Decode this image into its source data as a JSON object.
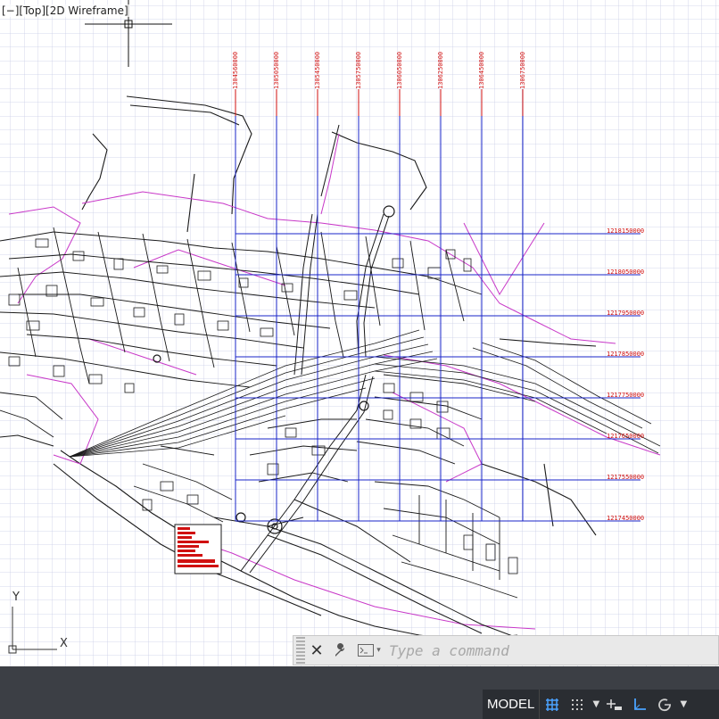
{
  "viewport": {
    "controls_label": "[−][Top][2D Wireframe]",
    "ucs_y": "Y",
    "ucs_x": "X"
  },
  "grid_labels": {
    "vertical": [
      "1304560000",
      "1305050000",
      "1305450000",
      "1305750000",
      "1306050000",
      "1306250000",
      "1306450000",
      "1306750000"
    ],
    "horizontal": [
      "1218150000",
      "1218050000",
      "1217950000",
      "1217850000",
      "1217750000",
      "1217650000",
      "1217550000",
      "1217450000"
    ]
  },
  "command_line": {
    "placeholder": "Type a command",
    "close_icon": "close-icon",
    "customize_icon": "wrench-icon",
    "prompt_icon": "command-prompt-icon"
  },
  "status_bar": {
    "model_label": "MODEL",
    "icons": [
      "grid-display-icon",
      "snap-mode-icon",
      "infer-constraints-icon",
      "ortho-icon",
      "polar-tracking-icon"
    ]
  },
  "colors": {
    "grid": "#c9cde6",
    "blue_grid": "#1a24c8",
    "magenta": "#c838c8",
    "linework": "#1a1a1a",
    "label_red": "#d01010",
    "status_bg": "#3c3f45"
  }
}
